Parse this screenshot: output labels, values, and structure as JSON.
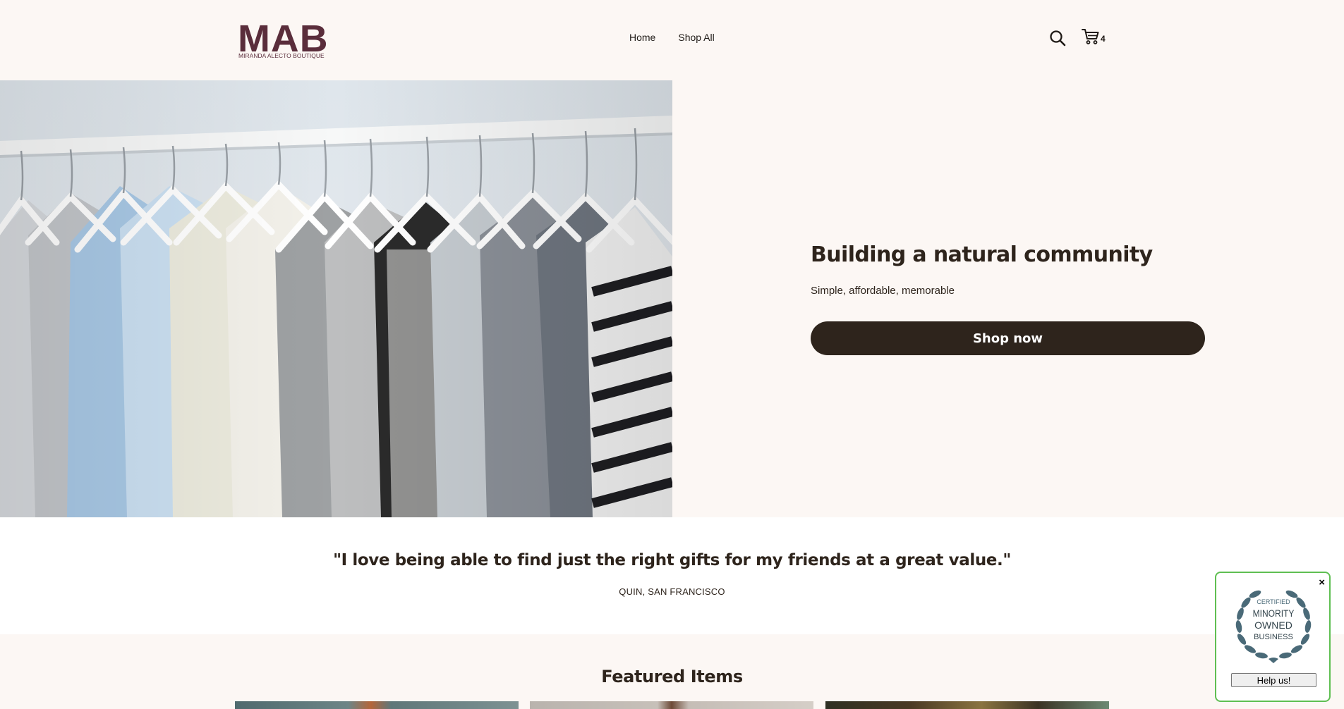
{
  "header": {
    "logo": {
      "mark": "MAB",
      "subtitle": "MIRANDA ALECTO BOUTIQUE"
    },
    "nav": [
      {
        "label": "Home"
      },
      {
        "label": "Shop All"
      }
    ],
    "search_icon": "search-icon",
    "cart_icon": "cart-icon",
    "cart_count": "4"
  },
  "hero": {
    "image": "clothes-on-hangers-rack",
    "title": "Building a natural community",
    "subtitle": "Simple, affordable, memorable",
    "button_label": "Shop now"
  },
  "testimonial": {
    "quote": "\"I love being able to find just the right gifts for my friends at a great value.\"",
    "author": "QUIN, SAN FRANCISCO"
  },
  "featured": {
    "title": "Featured Items"
  },
  "badge": {
    "close_label": "×",
    "seal_top": "CERTIFIED",
    "seal_line1": "MINORITY",
    "seal_line2": "OWNED",
    "seal_line3": "BUSINESS",
    "button_label": "Help us!"
  },
  "colors": {
    "background": "#fcf7f4",
    "text": "#2e241c",
    "button": "#2e241c",
    "logo": "#5a2d3b",
    "badge_border": "#5fbf52",
    "seal": "#4a6a78"
  }
}
